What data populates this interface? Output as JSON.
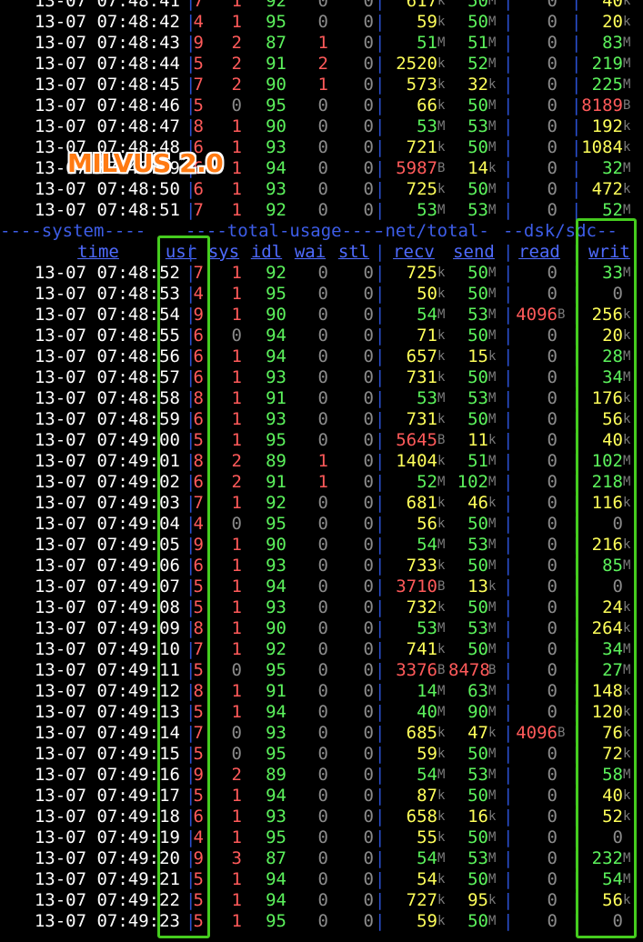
{
  "logo": "MILVUS 2.0",
  "colors": {
    "background": "#000000",
    "time": "#ffffff",
    "red": "#ff5a5a",
    "green": "#5cf25c",
    "yellow": "#ffff5a",
    "gray": "#8a8a8a",
    "unit": "#7a7a7a",
    "header": "#4f6bff",
    "separator": "#2a4fd0",
    "highlight_box": "#45cc1e"
  },
  "group_headers": [
    "----system----",
    "----total-usage----",
    "-net/total-",
    "--dsk/sdc--"
  ],
  "columns": [
    "time",
    "usr",
    "sys",
    "idl",
    "wai",
    "stl",
    "recv",
    "send",
    "read",
    "writ"
  ],
  "rows_before": [
    [
      "13-07 07:48:41",
      "7",
      "1",
      "92",
      "0",
      "0",
      "617",
      "k",
      "50",
      "M",
      "0",
      "",
      "40",
      "k"
    ],
    [
      "13-07 07:48:42",
      "4",
      "1",
      "95",
      "0",
      "0",
      "59",
      "k",
      "50",
      "M",
      "0",
      "",
      "20",
      "k"
    ],
    [
      "13-07 07:48:43",
      "9",
      "2",
      "87",
      "1",
      "0",
      "51",
      "M",
      "51",
      "M",
      "0",
      "",
      "83",
      "M"
    ],
    [
      "13-07 07:48:44",
      "5",
      "2",
      "91",
      "2",
      "0",
      "2520",
      "k",
      "52",
      "M",
      "0",
      "",
      "219",
      "M"
    ],
    [
      "13-07 07:48:45",
      "7",
      "2",
      "90",
      "1",
      "0",
      "573",
      "k",
      "32",
      "k",
      "0",
      "",
      "225",
      "M"
    ],
    [
      "13-07 07:48:46",
      "5",
      "0",
      "95",
      "0",
      "0",
      "66",
      "k",
      "50",
      "M",
      "0",
      "",
      "8189",
      "B"
    ],
    [
      "13-07 07:48:47",
      "8",
      "1",
      "90",
      "0",
      "0",
      "53",
      "M",
      "53",
      "M",
      "0",
      "",
      "192",
      "k"
    ],
    [
      "13-07 07:48:48",
      "6",
      "1",
      "93",
      "0",
      "0",
      "721",
      "k",
      "50",
      "M",
      "0",
      "",
      "1084",
      "k"
    ],
    [
      "13-07 07:48:49",
      "6",
      "1",
      "94",
      "0",
      "0",
      "5987",
      "B",
      "14",
      "k",
      "0",
      "",
      "32",
      "M"
    ],
    [
      "13-07 07:48:50",
      "6",
      "1",
      "93",
      "0",
      "0",
      "725",
      "k",
      "50",
      "M",
      "0",
      "",
      "472",
      "k"
    ],
    [
      "13-07 07:48:51",
      "7",
      "1",
      "92",
      "0",
      "0",
      "53",
      "M",
      "53",
      "M",
      "0",
      "",
      "52",
      "M"
    ]
  ],
  "rows_after": [
    [
      "13-07 07:48:52",
      "7",
      "1",
      "92",
      "0",
      "0",
      "725",
      "k",
      "50",
      "M",
      "0",
      "",
      "33",
      "M"
    ],
    [
      "13-07 07:48:53",
      "4",
      "1",
      "95",
      "0",
      "0",
      "50",
      "k",
      "50",
      "M",
      "0",
      "",
      "0",
      ""
    ],
    [
      "13-07 07:48:54",
      "9",
      "1",
      "90",
      "0",
      "0",
      "54",
      "M",
      "53",
      "M",
      "4096",
      "B",
      "256",
      "k"
    ],
    [
      "13-07 07:48:55",
      "6",
      "0",
      "94",
      "0",
      "0",
      "71",
      "k",
      "50",
      "M",
      "0",
      "",
      "20",
      "k"
    ],
    [
      "13-07 07:48:56",
      "6",
      "1",
      "94",
      "0",
      "0",
      "657",
      "k",
      "15",
      "k",
      "0",
      "",
      "28",
      "M"
    ],
    [
      "13-07 07:48:57",
      "6",
      "1",
      "93",
      "0",
      "0",
      "731",
      "k",
      "50",
      "M",
      "0",
      "",
      "34",
      "M"
    ],
    [
      "13-07 07:48:58",
      "8",
      "1",
      "91",
      "0",
      "0",
      "53",
      "M",
      "53",
      "M",
      "0",
      "",
      "176",
      "k"
    ],
    [
      "13-07 07:48:59",
      "6",
      "1",
      "93",
      "0",
      "0",
      "731",
      "k",
      "50",
      "M",
      "0",
      "",
      "56",
      "k"
    ],
    [
      "13-07 07:49:00",
      "5",
      "1",
      "95",
      "0",
      "0",
      "5645",
      "B",
      "11",
      "k",
      "0",
      "",
      "40",
      "k"
    ],
    [
      "13-07 07:49:01",
      "8",
      "2",
      "89",
      "1",
      "0",
      "1404",
      "k",
      "51",
      "M",
      "0",
      "",
      "102",
      "M"
    ],
    [
      "13-07 07:49:02",
      "6",
      "2",
      "91",
      "1",
      "0",
      "52",
      "M",
      "102",
      "M",
      "0",
      "",
      "218",
      "M"
    ],
    [
      "13-07 07:49:03",
      "7",
      "1",
      "92",
      "0",
      "0",
      "681",
      "k",
      "46",
      "k",
      "0",
      "",
      "116",
      "k"
    ],
    [
      "13-07 07:49:04",
      "4",
      "0",
      "95",
      "0",
      "0",
      "56",
      "k",
      "50",
      "M",
      "0",
      "",
      "0",
      ""
    ],
    [
      "13-07 07:49:05",
      "9",
      "1",
      "90",
      "0",
      "0",
      "54",
      "M",
      "53",
      "M",
      "0",
      "",
      "216",
      "k"
    ],
    [
      "13-07 07:49:06",
      "6",
      "1",
      "93",
      "0",
      "0",
      "733",
      "k",
      "50",
      "M",
      "0",
      "",
      "85",
      "M"
    ],
    [
      "13-07 07:49:07",
      "5",
      "1",
      "94",
      "0",
      "0",
      "3710",
      "B",
      "13",
      "k",
      "0",
      "",
      "0",
      ""
    ],
    [
      "13-07 07:49:08",
      "5",
      "1",
      "93",
      "0",
      "0",
      "732",
      "k",
      "50",
      "M",
      "0",
      "",
      "24",
      "k"
    ],
    [
      "13-07 07:49:09",
      "8",
      "1",
      "90",
      "0",
      "0",
      "53",
      "M",
      "53",
      "M",
      "0",
      "",
      "264",
      "k"
    ],
    [
      "13-07 07:49:10",
      "7",
      "1",
      "92",
      "0",
      "0",
      "741",
      "k",
      "50",
      "M",
      "0",
      "",
      "34",
      "M"
    ],
    [
      "13-07 07:49:11",
      "5",
      "0",
      "95",
      "0",
      "0",
      "3376",
      "B",
      "8478",
      "B",
      "0",
      "",
      "27",
      "M"
    ],
    [
      "13-07 07:49:12",
      "8",
      "1",
      "91",
      "0",
      "0",
      "14",
      "M",
      "63",
      "M",
      "0",
      "",
      "148",
      "k"
    ],
    [
      "13-07 07:49:13",
      "5",
      "1",
      "94",
      "0",
      "0",
      "40",
      "M",
      "90",
      "M",
      "0",
      "",
      "120",
      "k"
    ],
    [
      "13-07 07:49:14",
      "7",
      "0",
      "93",
      "0",
      "0",
      "685",
      "k",
      "47",
      "k",
      "4096",
      "B",
      "76",
      "k"
    ],
    [
      "13-07 07:49:15",
      "5",
      "0",
      "95",
      "0",
      "0",
      "59",
      "k",
      "50",
      "M",
      "0",
      "",
      "72",
      "k"
    ],
    [
      "13-07 07:49:16",
      "9",
      "2",
      "89",
      "0",
      "0",
      "54",
      "M",
      "53",
      "M",
      "0",
      "",
      "58",
      "M"
    ],
    [
      "13-07 07:49:17",
      "5",
      "1",
      "94",
      "0",
      "0",
      "87",
      "k",
      "50",
      "M",
      "0",
      "",
      "40",
      "k"
    ],
    [
      "13-07 07:49:18",
      "6",
      "1",
      "93",
      "0",
      "0",
      "658",
      "k",
      "16",
      "k",
      "0",
      "",
      "52",
      "k"
    ],
    [
      "13-07 07:49:19",
      "4",
      "1",
      "95",
      "0",
      "0",
      "55",
      "k",
      "50",
      "M",
      "0",
      "",
      "0",
      ""
    ],
    [
      "13-07 07:49:20",
      "9",
      "3",
      "87",
      "0",
      "0",
      "54",
      "M",
      "53",
      "M",
      "0",
      "",
      "232",
      "M"
    ],
    [
      "13-07 07:49:21",
      "5",
      "1",
      "94",
      "0",
      "0",
      "54",
      "k",
      "50",
      "M",
      "0",
      "",
      "54",
      "M"
    ],
    [
      "13-07 07:49:22",
      "5",
      "1",
      "94",
      "0",
      "0",
      "727",
      "k",
      "95",
      "k",
      "0",
      "",
      "56",
      "k"
    ],
    [
      "13-07 07:49:23",
      "5",
      "1",
      "95",
      "0",
      "0",
      "59",
      "k",
      "50",
      "M",
      "0",
      "",
      "0",
      ""
    ]
  ]
}
